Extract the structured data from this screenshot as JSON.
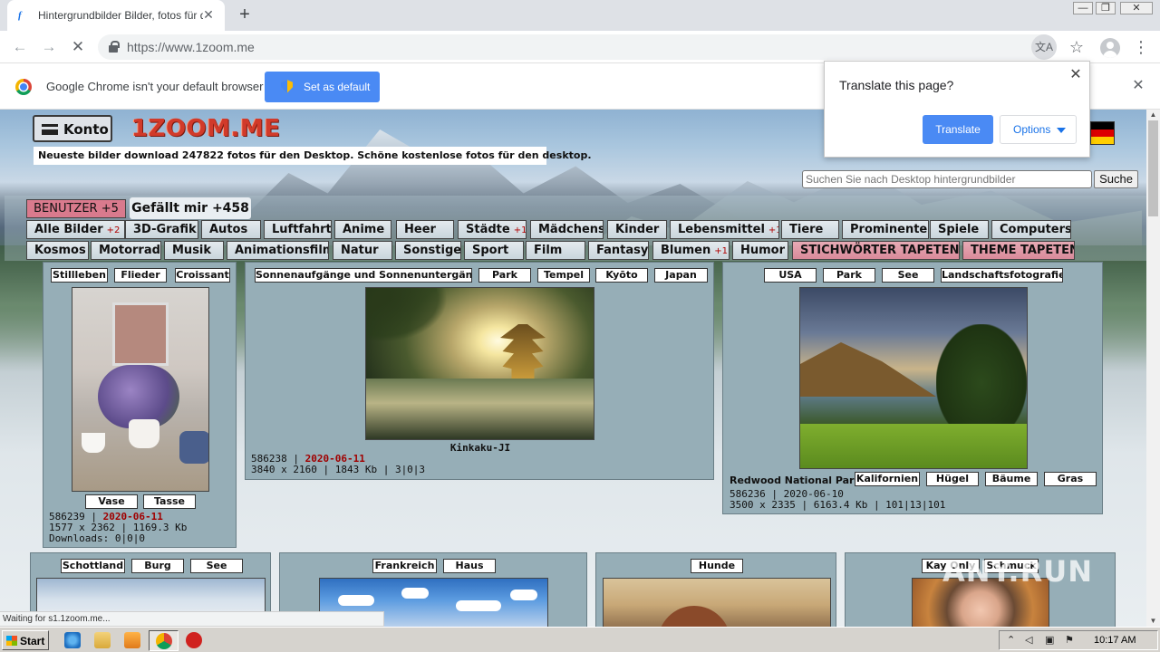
{
  "browser": {
    "tab_title": "Hintergrundbilder Bilder, fotos für desktop",
    "tab_favicon": "f",
    "tab_close": "✕",
    "new_tab": "+",
    "url": "https://www.1zoom.me",
    "window_controls": [
      "—",
      "❐",
      "✕"
    ],
    "back_icon": "←",
    "forward_icon": "→",
    "reload_icon": "✕",
    "star_icon": "☆",
    "menu_icon": "⋮",
    "translate_icon": "文A"
  },
  "default_bar": {
    "message": "Google Chrome isn't your default browser",
    "button": "Set as default",
    "close": "✕"
  },
  "translate_popup": {
    "title": "Translate this page?",
    "translate": "Translate",
    "options": "Options",
    "close": "✕"
  },
  "site": {
    "konto": "Konto",
    "logo": "1ZOOM.ME",
    "tagline": "Neueste bilder download 247822 fotos für den Desktop. Schöne kostenlose fotos für den desktop.",
    "search_placeholder": "Suchen Sie nach Desktop hintergrundbilder",
    "search_button": "Suche",
    "benutzer": "BENUTZER +5",
    "gefallt": "Gefällt mir +458"
  },
  "categories_row1": [
    {
      "label": "Alle Bilder",
      "plus": "+2"
    },
    {
      "label": "3D-Grafik",
      "plus": ""
    },
    {
      "label": "Autos",
      "plus": ""
    },
    {
      "label": "Luftfahrt",
      "plus": ""
    },
    {
      "label": "Anime",
      "plus": ""
    },
    {
      "label": "Heer",
      "plus": ""
    },
    {
      "label": "Städte",
      "plus": "+1"
    },
    {
      "label": "Mädchens",
      "plus": ""
    },
    {
      "label": "Kinder",
      "plus": ""
    },
    {
      "label": "Lebensmittel",
      "plus": "+1"
    },
    {
      "label": "Tiere",
      "plus": ""
    },
    {
      "label": "Prominente",
      "plus": ""
    },
    {
      "label": "Spiele",
      "plus": ""
    },
    {
      "label": "Computers",
      "plus": ""
    }
  ],
  "categories_row2": [
    {
      "label": "Kosmos",
      "plus": ""
    },
    {
      "label": "Motorrad",
      "plus": ""
    },
    {
      "label": "Musik",
      "plus": ""
    },
    {
      "label": "Animationsfilm",
      "plus": ""
    },
    {
      "label": "Natur",
      "plus": ""
    },
    {
      "label": "Sonstige",
      "plus": ""
    },
    {
      "label": "Sport",
      "plus": ""
    },
    {
      "label": "Film",
      "plus": ""
    },
    {
      "label": "Fantasy",
      "plus": ""
    },
    {
      "label": "Blumen",
      "plus": "+1"
    },
    {
      "label": "Humor",
      "plus": ""
    },
    {
      "label": "STICHWÖRTER TAPETEN",
      "plus": ""
    },
    {
      "label": "THEME TAPETEN",
      "plus": ""
    }
  ],
  "cards": {
    "lilac": {
      "tags_top": [
        "Stillleben",
        "Flieder",
        "Croissant"
      ],
      "tags_bottom": [
        "Vase",
        "Tasse"
      ],
      "id": "586239 | ",
      "date": "2020-06-11",
      "size": "1577 x 2362 | 1169.3 Kb",
      "downloads": "Downloads: 0|0|0"
    },
    "kyoto": {
      "tags_top": [
        "Sonnenaufgänge und Sonnenuntergänge",
        "Park",
        "Tempel",
        "Kyōto",
        "Japan"
      ],
      "caption": "Kinkaku-JI",
      "id": "586238 | ",
      "date": "2020-06-11",
      "size": "3840 x 2160 | 1843 Kb | 3|0|3"
    },
    "redwood": {
      "tags_top": [
        "USA",
        "Park",
        "See",
        "Landschaftsfotografie"
      ],
      "caption": "Redwood National Park",
      "tags_bottom": [
        "Kalifornien",
        "Hügel",
        "Bäume",
        "Gras"
      ],
      "info1": "586236 | 2020-06-10",
      "info2": "3500 x 2335 | 6163.4 Kb | 101|13|101"
    },
    "scotland": {
      "tags_top": [
        "Schottland",
        "Burg",
        "See"
      ]
    },
    "france": {
      "tags_top": [
        "Frankreich",
        "Haus"
      ]
    },
    "dogs": {
      "tags_top": [
        "Hunde"
      ]
    },
    "kay": {
      "tags_top": [
        "Kay Only",
        "Schmuck"
      ]
    }
  },
  "status_text": "Waiting for s1.1zoom.me...",
  "watermark": "ANY.RUN",
  "taskbar": {
    "start": "Start",
    "clock": "10:17 AM"
  }
}
